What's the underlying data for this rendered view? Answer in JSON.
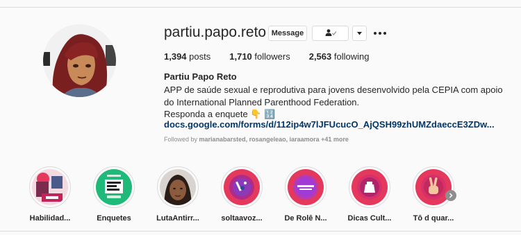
{
  "profile": {
    "username": "partiu.papo.reto",
    "message_label": "Message",
    "posts_count": "1,394",
    "posts_label": "posts",
    "followers_count": "1,710",
    "followers_label": "followers",
    "following_count": "2,563",
    "following_label": "following",
    "full_name": "Partiu Papo Reto",
    "bio_line1": "APP de saúde sexual e reprodutiva para jovens desenvolvido pela CEPIA com apoio",
    "bio_line2": "do International Planned Parenthood Federation.",
    "bio_line3": "Responda a enquete 👇 🔢",
    "link": "docs.google.com/forms/d/112ip4w7lJFUcucO_AjQSH99zhUMZdaeccE3ZDw...",
    "followed_prefix": "Followed by",
    "followed_names": "marianabarsted, rosangeleao, iaraamora",
    "followed_more": "+41 more"
  },
  "icons": {
    "follow": "person-check-icon",
    "dropdown": "caret-down-icon",
    "more": "more-options-icon",
    "next": "chevron-right-icon"
  },
  "highlights": [
    {
      "label": "Habilidad..."
    },
    {
      "label": "Enquetes"
    },
    {
      "label": "LutaAntirr..."
    },
    {
      "label": "soltaavoz..."
    },
    {
      "label": "De Rolê N..."
    },
    {
      "label": "Dicas Cult..."
    },
    {
      "label": "Tô d quar..."
    }
  ],
  "colors": {
    "link": "#00376b",
    "enquetes_green": "#1fb97a",
    "pink": "#e5385d",
    "purple": "#a23bd6"
  }
}
